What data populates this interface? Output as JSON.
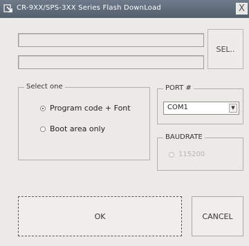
{
  "window": {
    "title": "CR-9XX/SPS-3XX Series Flash DownLoad",
    "close_label": "X"
  },
  "fields": {
    "line1_value": "",
    "line2_value": ""
  },
  "sel_button_label": "SEL..",
  "select_one": {
    "legend": "Select one",
    "options": [
      {
        "label": "Program code + Font",
        "checked": true
      },
      {
        "label": "Boot area only",
        "checked": false
      }
    ]
  },
  "port": {
    "legend": "PORT #",
    "selected": "COM1"
  },
  "baudrate": {
    "legend": "BAUDRATE",
    "option_label": "115200",
    "enabled": false
  },
  "buttons": {
    "ok_label": "OK",
    "cancel_label": "CANCEL"
  }
}
